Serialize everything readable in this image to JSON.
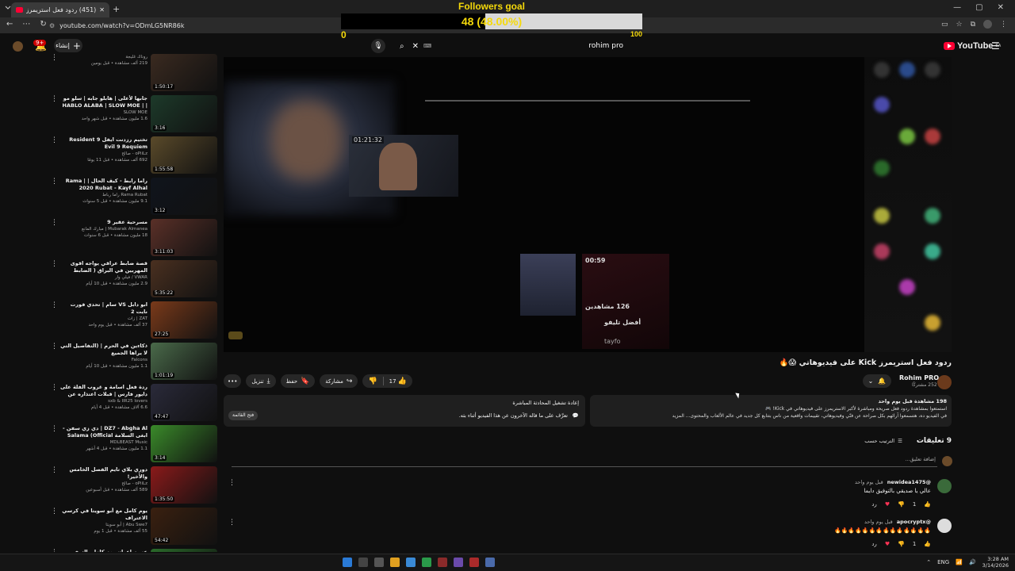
{
  "browser": {
    "tab_title": "(451) ردود فعل استريمرز Kick على",
    "url": "youtube.com/watch?v=ODmLG5NR86k",
    "new_tab_symbol": "+",
    "window_buttons": [
      "—",
      "▢",
      "✕"
    ]
  },
  "overlay": {
    "goal_title": "Followers goal",
    "current_count": "48",
    "percent_text": "(48.00%)",
    "progress_fraction": 0.48,
    "min_label": "0",
    "max_label": "100"
  },
  "masthead": {
    "create_label": "إنشاء",
    "notification_count": "9+",
    "search_query": "rohim pro",
    "logo_text": "YouTube",
    "logo_region": "SA"
  },
  "related": [
    {
      "title": "",
      "channel": "روناك غليجة",
      "meta": "219 ألف مشاهدة • قبل يومين",
      "duration": "1:50:17",
      "thumb": "#3a2a20"
    },
    {
      "title": "جابها لأعلى | هابلو جابه | سلو مو | HABLO ALABA | SLOW MOE | JABAHA",
      "channel": "SLOW MOE",
      "meta": "1.6 مليون مشاهدة • قبل شهر واحد",
      "duration": "3:16",
      "thumb": "#1d3a2a"
    },
    {
      "title": "تختيم رزدنت ايفل 9 Resident Evil 9 Requiem",
      "channel": "oPiiLz - صالح",
      "meta": "692 ألف مشاهدة • قبل 11 يومًا",
      "duration": "1:55:58",
      "thumb": "#5a4a2a"
    },
    {
      "title": "راما رابط - كيف الحال | Rama | 2020 Rubat - Kayf Alhal",
      "channel": "Rama Rubat راما رباط",
      "meta": "9.1 مليون مشاهدة • قبل 5 سنوات",
      "duration": "3:12",
      "thumb": "#10141c"
    },
    {
      "title": "مسرحية عقير 9",
      "channel": "Mubarak Almanea | مبارك المانع",
      "meta": "18 مليون مشاهدة • قبل 6 سنوات",
      "duration": "3:11:03",
      "thumb": "#5a3028"
    },
    {
      "title": "قصة ضابط عراقي يواجه اقوى المهربين في البراق ( الضابط العراب ) |",
      "channel": "VWAR / فيلي وار",
      "meta": "2.9 مليون مشاهدة • قبل 10 أيام",
      "duration": "5:35:22",
      "thumb": "#4a3020"
    },
    {
      "title": "ابو دابل VS سام | تحدي فورت نايت 2",
      "channel": "ZAT | زات",
      "meta": "37 ألف مشاهدة • قبل يوم واحد",
      "duration": "27:25",
      "thumb": "#7a3a1a"
    },
    {
      "title": "ذكاءين في الحرم | (التفاصيل التي لا يراها الجميع",
      "channel": "Falcons",
      "meta": "1.1 مليون مشاهدة • قبل 10 أيام",
      "duration": "1:01:19",
      "thumb": "#4a6a4a"
    },
    {
      "title": "ردة فعل اسامة و غروب الفلة على دايور فارس | قبلات اعتذاره عن بطولين امتهانهم ...",
      "channel": "sxb & IIR25 lovers",
      "meta": "6.6 آلاف مشاهدة • قبل 4 أيام",
      "duration": "47:47",
      "thumb": "#2a2a3a"
    },
    {
      "title": "DZ7 - Abgha Al | دي زي سفن - ابغى السلامة Salama (Official Music Video)",
      "channel": "MDLBEAST Music",
      "meta": "1.1 مليون مشاهدة • قبل 4 أشهر",
      "duration": "3:14",
      "thumb": "#3a8a2a"
    },
    {
      "title": "دوري بلاي تايم الفصل الخامس والأخير!",
      "channel": "oPiiLz - صالح",
      "meta": "589 ألف مشاهدة • قبل أسبوعين",
      "duration": "1:35:50",
      "thumb": "#8a1a1a"
    },
    {
      "title": "يوم كامل مع أبو سويتا في كرسي الاعتراف",
      "channel": "Abu Swe7 | أبو سويتا",
      "meta": "55 ألف مشاهدة • قبل 1 يوم",
      "duration": "54:42",
      "thumb": "#3a2010"
    },
    {
      "title": "عزبت اعوان يوم كامل بالسفر الانتهاء !",
      "channel": "",
      "meta": "",
      "duration": "",
      "thumb": "#2a6a2a"
    }
  ],
  "player": {
    "inset_time": "01:21:32",
    "mini_time": "00:59",
    "mini_views": "126 مشاهدين",
    "mini_name": "أفضل تليفو",
    "mini_sub": "tayfo"
  },
  "video": {
    "title": "ردود فعل استريمرز Kick على فيديوهاتي 😱🔥",
    "channel_name": "Rohim PRO",
    "channel_subs": "252 مشتركًا",
    "like_count": "17",
    "share_label": "مشاركة",
    "save_label": "حفظ",
    "download_label": "تنزيل",
    "more_label": "•••"
  },
  "description": {
    "line1": "198 مشاهدة قبل يوم واحد",
    "line2": "استمتعوا بمشاهدة ردود فعل صريحة ومباشرة لأكبر الاستريمرز على فيديوهاتي في Kick! 🎮",
    "line3": "في الفيديو ده، هتسمعوا آرائهم بكل صراحة عن فنّي وفيديوهاتي، تقييمات واقعية من ناس بتتابع كل جديد في عالم الألعاب والمحتوى... المزيد"
  },
  "livechat": {
    "title": "إعادة تشغيل المحادثة المباشرة",
    "line": "تعرَّف على ما قاله الآخرون عن هذا الفيديو أثناء بثه.",
    "button": "فتح القائمة"
  },
  "comments_header": {
    "count": "9 تعليقات",
    "sort_label": "الترتيب حسب",
    "add_placeholder": "إضافة تعليق..."
  },
  "comments": [
    {
      "author": "@newidea1475",
      "time": "قبل يوم واحد",
      "text": "عالي يا صديقي بالتوفيق دايما",
      "likes": "1",
      "reply": "رد",
      "avatar": "#3a6a3a"
    },
    {
      "author": "@apocryptx",
      "time": "قبل يوم واحد",
      "text": "🔥🔥🔥🔥🔥🔥🔥🔥🔥🔥🔥🔥🔥🔥",
      "likes": "1",
      "reply": "رد",
      "avatar": "#dddddd"
    }
  ],
  "taskbar": {
    "lang": "ENG",
    "time": "3:28 AM",
    "date": "3/14/2026"
  }
}
